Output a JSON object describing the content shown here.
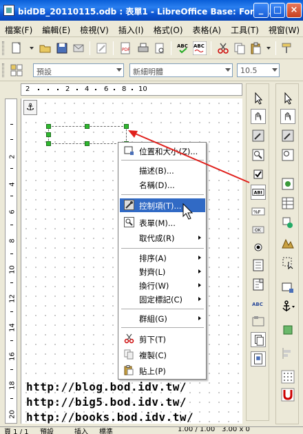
{
  "window": {
    "title": "bidDB_20110115.odb : 表單1 - LibreOffice Base: Form ...",
    "minimize": "_",
    "maximize": "□",
    "close": "×"
  },
  "menubar": {
    "items": [
      "檔案(F)",
      "編輯(E)",
      "檢視(V)",
      "插入(I)",
      "格式(O)",
      "表格(A)",
      "工具(T)",
      "視窗(W)",
      "說"
    ]
  },
  "format_toolbar": {
    "style_value": "預設",
    "font_value": "新細明體",
    "size_value": "10.5"
  },
  "ruler": {
    "h_labels": [
      "2",
      "2",
      "4",
      "6",
      "8",
      "10"
    ],
    "v_labels": [
      "2",
      "4",
      "6",
      "8",
      "10",
      "12",
      "14",
      "16",
      "18",
      "20"
    ]
  },
  "context_menu": {
    "items": [
      {
        "label": "位置和大小(Z)...",
        "icon": "position-size-icon",
        "submenu": false
      },
      {
        "label": "描述(B)...",
        "icon": "",
        "submenu": false
      },
      {
        "label": "名稱(D)...",
        "icon": "",
        "submenu": false
      },
      {
        "label": "控制項(T)...",
        "icon": "control-properties-icon",
        "submenu": false,
        "highlighted": true
      },
      {
        "label": "表單(M)...",
        "icon": "form-properties-icon",
        "submenu": false
      },
      {
        "label": "取代成(R)",
        "icon": "",
        "submenu": true
      },
      {
        "label": "排序(A)",
        "icon": "",
        "submenu": true
      },
      {
        "label": "對齊(L)",
        "icon": "",
        "submenu": true
      },
      {
        "label": "換行(W)",
        "icon": "",
        "submenu": true
      },
      {
        "label": "固定標記(C)",
        "icon": "",
        "submenu": true
      },
      {
        "label": "群組(G)",
        "icon": "",
        "submenu": true
      },
      {
        "label": "剪下(T)",
        "icon": "scissors-icon",
        "submenu": false
      },
      {
        "label": "複製(C)",
        "icon": "copy-icon",
        "submenu": false
      },
      {
        "label": "貼上(P)",
        "icon": "paste-icon",
        "submenu": false
      }
    ]
  },
  "watermark": {
    "urls": [
      "http://blog.bod.idv.tw/",
      "http://big5.bod.idv.tw/",
      "http://books.bod.idv.tw/"
    ]
  },
  "statusbar": {
    "page": "頁 1 / 1",
    "style": "預設",
    "mode": "插入",
    "selection": "標準",
    "position": "1.00 / 1.00",
    "size": "3.00 x 0"
  },
  "colors": {
    "titlebar": "#0b54d0",
    "highlight": "#316ac5",
    "handle": "#2eb82e",
    "arrow": "#e0201c"
  }
}
